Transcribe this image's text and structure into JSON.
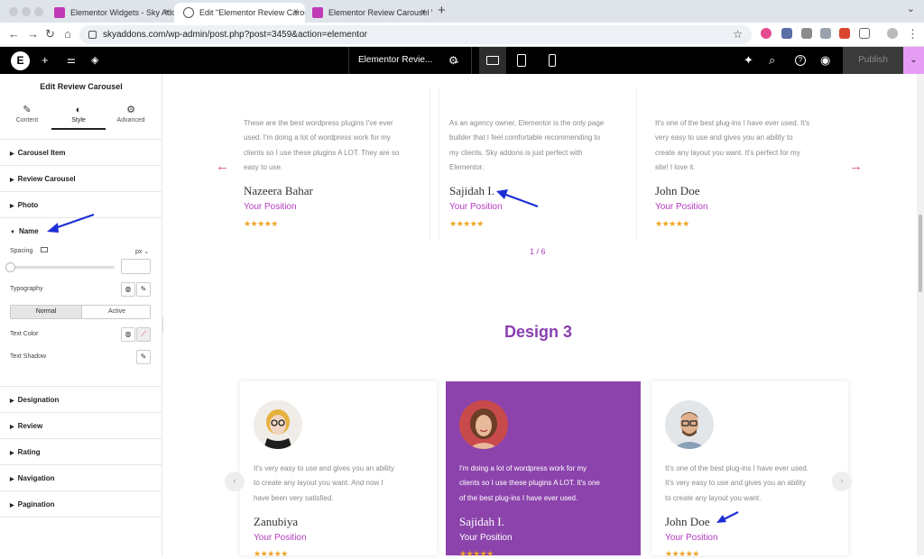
{
  "browser": {
    "tabs": [
      {
        "title": "Elementor Widgets - Sky Add",
        "active": false
      },
      {
        "title": "Edit \"Elementor Review Carou",
        "active": true
      },
      {
        "title": "Elementor Review Carousel W",
        "active": false
      }
    ],
    "new_tab": "+",
    "close_glyph": "×",
    "url": "skyaddons.com/wp-admin/post.php?post=3459&action=elementor"
  },
  "editor": {
    "logo": "E",
    "page_title": "Elementor Revie...",
    "publish_label": "Publish"
  },
  "panel": {
    "title": "Edit Review Carousel",
    "tabs": [
      {
        "label": "Content",
        "icon": "pencil-icon"
      },
      {
        "label": "Style",
        "icon": "contrast-icon"
      },
      {
        "label": "Advanced",
        "icon": "gear-icon"
      }
    ],
    "sections_top": [
      "Carousel Item",
      "Review Carousel",
      "Photo"
    ],
    "name_section": "Name",
    "spacing_label": "Spacing",
    "spacing_unit": "px",
    "typography_label": "Typography",
    "state_tabs": [
      "Normal",
      "Active"
    ],
    "text_color_label": "Text Color",
    "text_shadow_label": "Text Shadow",
    "sections_bottom": [
      "Designation",
      "Review",
      "Rating",
      "Navigation",
      "Pagination"
    ]
  },
  "carousel1": {
    "reviews": [
      {
        "text": [
          "These are the best wordpress plugins I've ever",
          "used. I'm doing a lot of wordpress work for my",
          "clients so I use these plugins A LOT. They are so",
          "easy to use."
        ],
        "name": "Nazeera Bahar",
        "position": "Your Position"
      },
      {
        "text": [
          "As an agency owner, Elementor is the only page",
          "builder that I feel comfortable recommending to",
          "my clients. Sky addons is just perfect with",
          "Elementor."
        ],
        "name": "Sajidah I.",
        "position": "Your Position"
      },
      {
        "text": [
          "It's one of the best plug-ins I have ever used. It's",
          "very easy to use and gives you an ability to",
          "create any layout you want. It's perfect for my",
          "site! I love it."
        ],
        "name": "John Doe",
        "position": "Your Position"
      }
    ],
    "pager": "1 / 6",
    "stars": "★★★★★"
  },
  "design3": {
    "heading": "Design 3",
    "reviews": [
      {
        "text": [
          "It's very easy to use and gives you an ability",
          "to create any layout you want. And now I",
          "have been very satisfied."
        ],
        "name": "Zanubiya",
        "position": "Your Position"
      },
      {
        "text": [
          "I'm doing a lot of wordpress work for my",
          "clients so I use these plugins A LOT. It's one",
          "of the best plug-ins I have ever used."
        ],
        "name": "Sajidah I.",
        "position": "Your Position"
      },
      {
        "text": [
          "It's one of the best plug-ins I have ever used.",
          "It's very easy to use and gives you an ability",
          "to create any layout you want."
        ],
        "name": "John Doe",
        "position": "Your Position"
      }
    ]
  },
  "colors": {
    "accent": "#b43ac1",
    "featured_card": "#8c44ac",
    "heading": "#8a3fb0",
    "star": "#f0a324",
    "annotation": "#1c2fd6"
  }
}
